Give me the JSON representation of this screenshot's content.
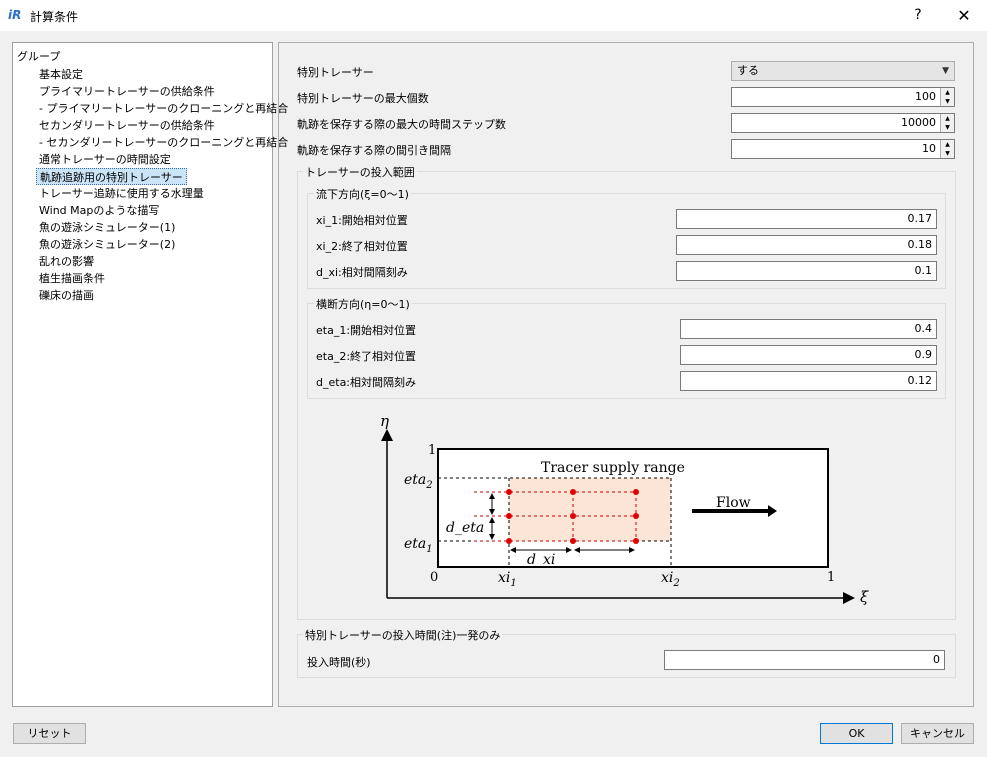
{
  "window": {
    "title": "計算条件",
    "help_label": "?",
    "close_label": "✕"
  },
  "sidebar": {
    "header": "グループ",
    "items": [
      "基本設定",
      "プライマリートレーサーの供給条件",
      "- プライマリートレーサーのクローニングと再結合",
      "セカンダリートレーサーの供給条件",
      "- セカンダリートレーサーのクローニングと再結合",
      "通常トレーサーの時間設定",
      "軌跡追跡用の特別トレーサー",
      "トレーサー追跡に使用する水理量",
      "Wind Mapのような描写",
      "魚の遊泳シミュレーター(1)",
      "魚の遊泳シミュレーター(2)",
      "乱れの影響",
      "植生描画条件",
      "礫床の描画"
    ],
    "selected_index": 6
  },
  "main": {
    "special_tracer_label": "特別トレーサー",
    "special_tracer_value": "する",
    "max_count_label": "特別トレーサーの最大個数",
    "max_count_value": "100",
    "max_steps_label": "軌跡を保存する際の最大の時間ステップ数",
    "max_steps_value": "10000",
    "thinning_label": "軌跡を保存する際の間引き間隔",
    "thinning_value": "10",
    "range_group_title": "トレーサーの投入範囲",
    "stream_group_title": "流下方向(ξ=0〜1)",
    "xi1_label": "xi_1:開始相対位置",
    "xi1_value": "0.17",
    "xi2_label": "xi_2:終了相対位置",
    "xi2_value": "0.18",
    "dxi_label": "d_xi:相対間隔刻み",
    "dxi_value": "0.1",
    "cross_group_title": "横断方向(η=0〜1)",
    "eta1_label": "eta_1:開始相対位置",
    "eta1_value": "0.4",
    "eta2_label": "eta_2:終了相対位置",
    "eta2_value": "0.9",
    "deta_label": "d_eta:相対間隔刻み",
    "deta_value": "0.12",
    "time_group_title": "特別トレーサーの投入時間(注)一発のみ",
    "time_label": "投入時間(秒)",
    "time_value": "0"
  },
  "diagram": {
    "eta_axis": "η",
    "xi_axis": "ξ",
    "one_top": "1",
    "zero": "0",
    "one_right": "1",
    "eta2_label": "eta",
    "eta2_sub": "2",
    "eta1_label": "eta",
    "eta1_sub": "1",
    "deta_label": "d_eta",
    "dxi_label": "d_xi",
    "xi1_label": "xi",
    "xi1_sub": "1",
    "xi2_label": "xi",
    "xi2_sub": "2",
    "supply_label": "Tracer supply range",
    "flow_label": "Flow"
  },
  "footer": {
    "reset_label": "リセット",
    "ok_label": "OK",
    "cancel_label": "キャンセル"
  },
  "colors": {
    "selection": "#cce4f7",
    "supply_fill": "#fbe5d6",
    "point": "#e00000"
  }
}
